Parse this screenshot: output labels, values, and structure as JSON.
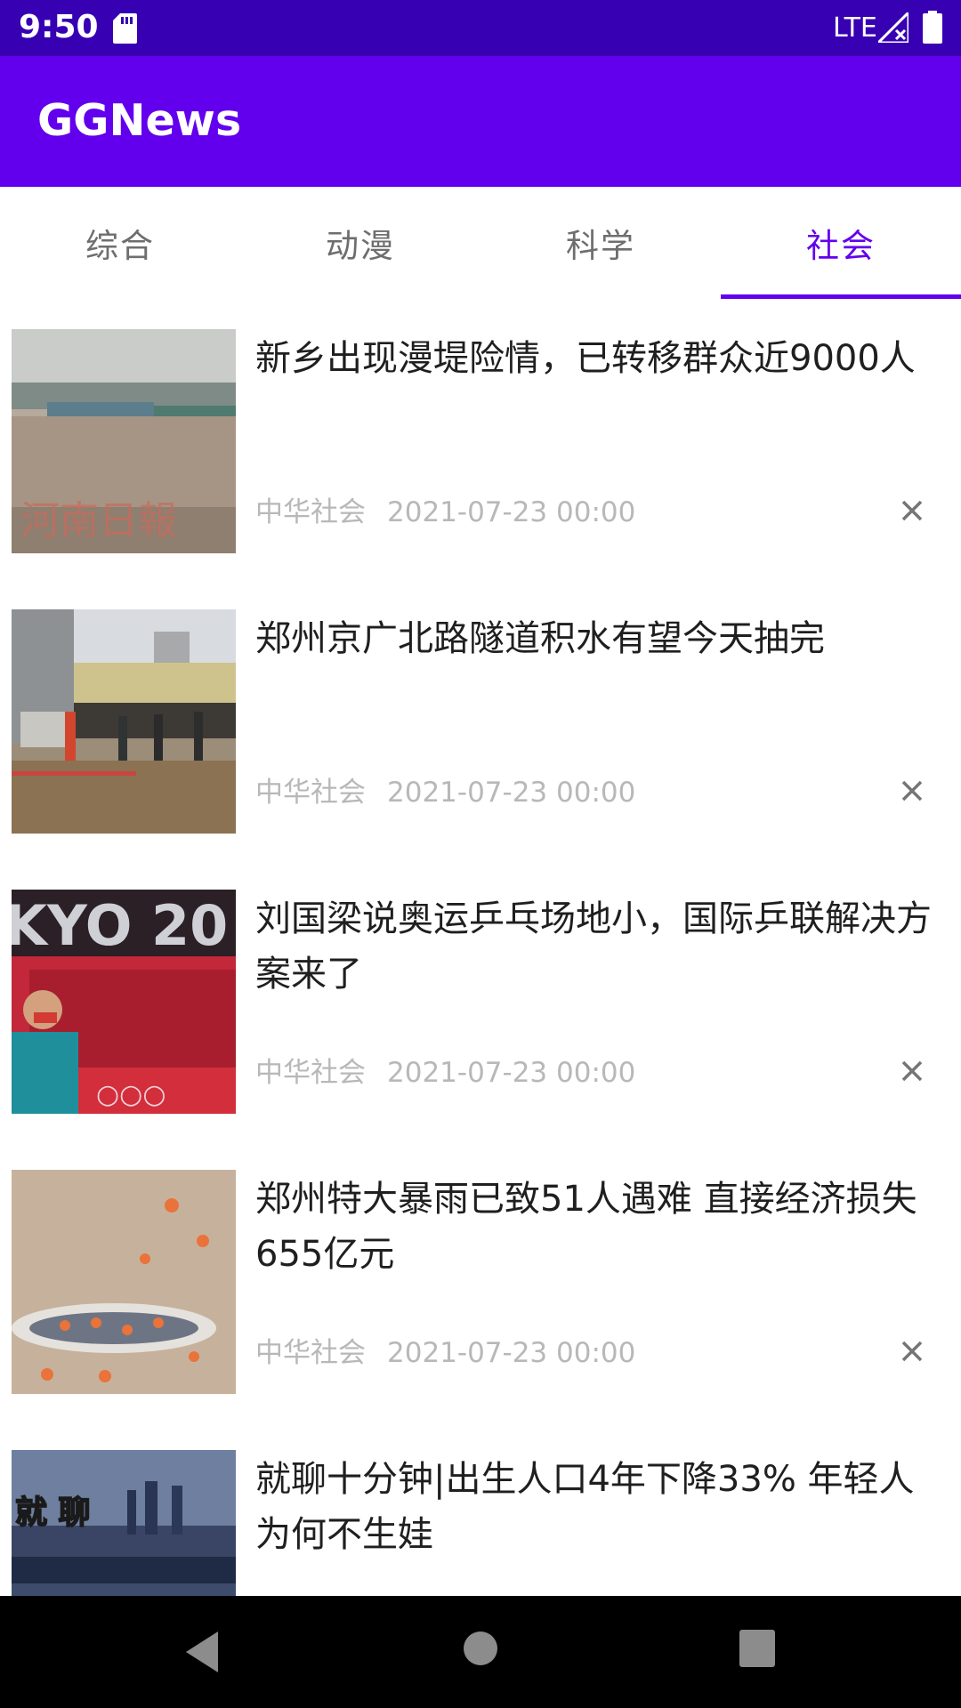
{
  "status_bar": {
    "time": "9:50",
    "network": "LTE"
  },
  "app_bar": {
    "title": "GGNews"
  },
  "tabs": [
    {
      "label": "综合",
      "active": false
    },
    {
      "label": "动漫",
      "active": false
    },
    {
      "label": "科学",
      "active": false
    },
    {
      "label": "社会",
      "active": true
    }
  ],
  "news": [
    {
      "title": "新乡出现漫堤险情，已转移群众近9000人",
      "source": "中华社会",
      "date": "2021-07-23 00:00",
      "thumb": "flood-river-photo"
    },
    {
      "title": "郑州京广北路隧道积水有望今天抽完",
      "source": "中华社会",
      "date": "2021-07-23 00:00",
      "thumb": "tunnel-rescue-photo"
    },
    {
      "title": "刘国梁说奥运乒乓场地小，国际乒联解决方案来了",
      "source": "中华社会",
      "date": "2021-07-23 00:00",
      "thumb": "tokyo-olympics-photo"
    },
    {
      "title": "郑州特大暴雨已致51人遇难 直接经济损失655亿元",
      "source": "中华社会",
      "date": "2021-07-23 00:00",
      "thumb": "boat-rescue-photo"
    },
    {
      "title": "就聊十分钟|出生人口4年下降33% 年轻人为何不生娃",
      "source": "",
      "date": "",
      "thumb": "city-night-photo"
    }
  ]
}
